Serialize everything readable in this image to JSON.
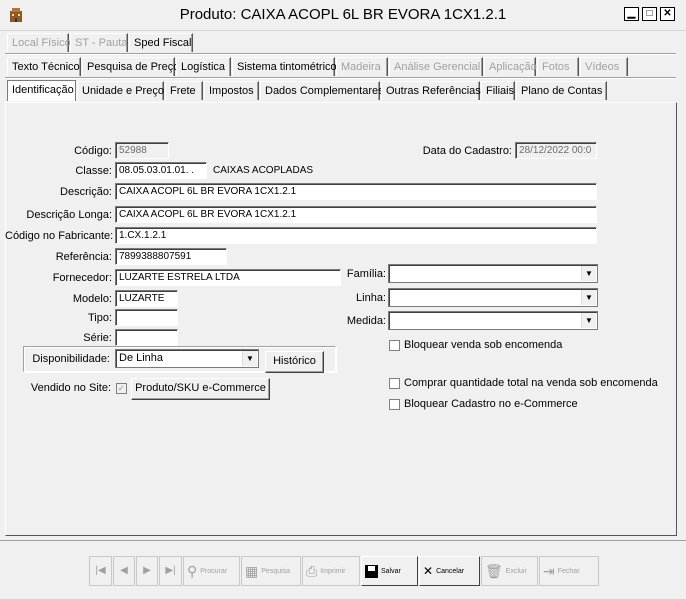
{
  "window": {
    "title": "Produto: CAIXA ACOPL 6L BR EVORA 1CX1.2.1",
    "min": "▁",
    "max": "□",
    "close": "✕"
  },
  "tabs_row1": [
    {
      "label": "Local Físico"
    },
    {
      "label": "ST - Pauta"
    },
    {
      "label": "Sped Fiscal"
    }
  ],
  "tabs_row2": [
    {
      "label": "Texto Técnico"
    },
    {
      "label": "Pesquisa de Preço"
    },
    {
      "label": "Logística"
    },
    {
      "label": "Sistema tintométrico"
    },
    {
      "label": "Madeira"
    },
    {
      "label": "Análise Gerencial"
    },
    {
      "label": "Aplicação"
    },
    {
      "label": "Fotos"
    },
    {
      "label": "Vídeos"
    }
  ],
  "tabs_row3": [
    {
      "label": "Identificação"
    },
    {
      "label": "Unidade e Preço"
    },
    {
      "label": "Frete"
    },
    {
      "label": "Impostos"
    },
    {
      "label": "Dados Complementares"
    },
    {
      "label": "Outras Referências"
    },
    {
      "label": "Filiais"
    },
    {
      "label": "Plano de Contas"
    }
  ],
  "form": {
    "codigo_label": "Código:",
    "codigo": "52988",
    "data_cadastro_label": "Data do Cadastro:",
    "data_cadastro": "28/12/2022 00:0",
    "classe_label": "Classe:",
    "classe": "08.05.03.01.01.  .",
    "classe_desc": "CAIXAS ACOPLADAS",
    "descricao_label": "Descrição:",
    "descricao": "CAIXA ACOPL 6L BR EVORA 1CX1.2.1",
    "descricao_longa_label": "Descrição Longa:",
    "descricao_longa": "CAIXA ACOPL 6L BR EVORA 1CX1.2.1",
    "codigo_fabricante_label": "Código no Fabricante:",
    "codigo_fabricante": "1.CX.1.2.1",
    "referencia_label": "Referência:",
    "referencia": "7899388807591",
    "fornecedor_label": "Fornecedor:",
    "fornecedor": "LUZARTE ESTRELA LTDA",
    "modelo_label": "Modelo:",
    "modelo": "LUZARTE",
    "tipo_label": "Tipo:",
    "tipo": "",
    "serie_label": "Série:",
    "serie": "",
    "familia_label": "Família:",
    "familia": "",
    "linha_label": "Linha:",
    "linha": "",
    "medida_label": "Medida:",
    "medida": "",
    "disponibilidade_label": "Disponibilidade:",
    "disponibilidade": "De Linha",
    "historico_button": "Histórico",
    "vendido_site_label": "Vendido no Site:",
    "produto_sku_button": "Produto/SKU e-Commerce",
    "bloquear_venda_label": "Bloquear venda sob encomenda",
    "comprar_quantidade_label": "Comprar quantidade total na venda sob encomenda",
    "bloquear_cadastro_label": "Bloquear Cadastro no e-Commerce"
  },
  "toolbar": {
    "procurar": "Procurar",
    "pesquisa": "Pesquisa",
    "imprimir": "Imprimir",
    "salvar": "Salvar",
    "cancelar": "Cancelar",
    "excluir": "Excluir",
    "fechar": "Fechar",
    "first": "|◀",
    "prev": "◀",
    "next": "▶",
    "last": "▶|"
  },
  "icons": {
    "app": "building-icon",
    "first": "first-record-icon",
    "prev": "previous-record-icon",
    "next": "next-record-icon",
    "last": "last-record-icon",
    "search": "binoculars-icon",
    "grid": "grid-icon",
    "print": "printer-icon",
    "save": "floppy-disk-icon",
    "cancel": "cancel-icon",
    "delete": "trash-icon",
    "close": "door-exit-icon"
  }
}
